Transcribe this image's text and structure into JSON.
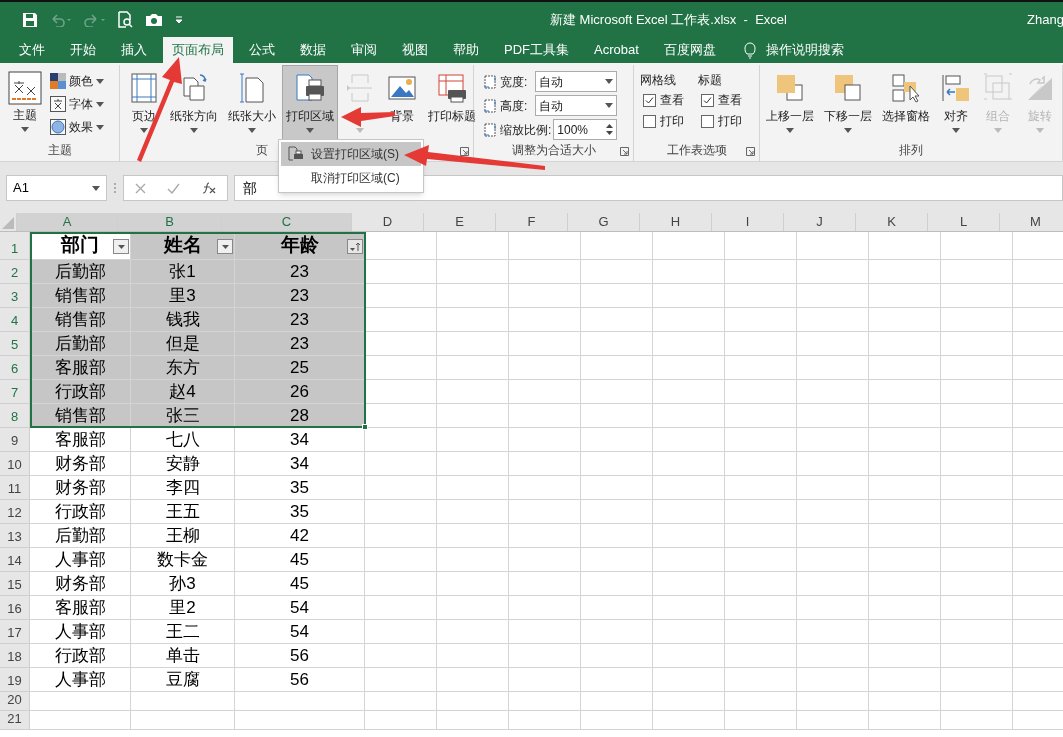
{
  "window": {
    "title": "新建 Microsoft Excel 工作表.xlsx  -  Excel",
    "user": "Zhang"
  },
  "tabs": [
    {
      "label": "文件",
      "selected": false
    },
    {
      "label": "开始",
      "selected": false
    },
    {
      "label": "插入",
      "selected": false
    },
    {
      "label": "页面布局",
      "selected": true
    },
    {
      "label": "公式",
      "selected": false
    },
    {
      "label": "数据",
      "selected": false
    },
    {
      "label": "审阅",
      "selected": false
    },
    {
      "label": "视图",
      "selected": false
    },
    {
      "label": "帮助",
      "selected": false
    },
    {
      "label": "PDF工具集",
      "selected": false
    },
    {
      "label": "Acrobat",
      "selected": false
    },
    {
      "label": "百度网盘",
      "selected": false
    }
  ],
  "tell_me": "操作说明搜索",
  "ribbon": {
    "groups": [
      {
        "kind": "theme",
        "label": "主题",
        "launcher": false,
        "large": {
          "label": "主题"
        },
        "small": [
          {
            "label": "颜色"
          },
          {
            "label": "字体"
          },
          {
            "label": "效果"
          }
        ]
      },
      {
        "kind": "large_buttons",
        "label": "页",
        "launcher": true,
        "items": [
          {
            "label": "页边",
            "pressed": false,
            "disabled": false,
            "has_menu": true
          },
          {
            "label": "纸张方向",
            "pressed": false,
            "disabled": false,
            "has_menu": true
          },
          {
            "label": "纸张大小",
            "pressed": false,
            "disabled": false,
            "has_menu": true
          },
          {
            "label": "打印区域",
            "pressed": true,
            "disabled": false,
            "has_menu": true
          },
          {
            "pressed": false,
            "disabled": true,
            "has_menu": true
          },
          {
            "label": "背景",
            "pressed": false,
            "disabled": false,
            "has_menu": false
          },
          {
            "label": "打印标题",
            "pressed": false,
            "disabled": false,
            "has_menu": false
          }
        ]
      },
      {
        "kind": "scale",
        "label": "调整为合适大小",
        "launcher": true,
        "fields": [
          {
            "label": "宽度:",
            "value": "自动",
            "kind": "dropdown"
          },
          {
            "label": "高度:",
            "value": "自动",
            "kind": "dropdown"
          },
          {
            "label": "缩放比例:",
            "value": "100%",
            "kind": "spin"
          }
        ]
      },
      {
        "kind": "sheet_options",
        "label": "工作表选项",
        "launcher": true,
        "sets": [
          {
            "title": "网格线",
            "options": [
              {
                "label": "查看",
                "checked": true
              },
              {
                "label": "打印",
                "checked": false
              }
            ]
          },
          {
            "title": "标题",
            "options": [
              {
                "label": "查看",
                "checked": true
              },
              {
                "label": "打印",
                "checked": false
              }
            ]
          }
        ]
      },
      {
        "kind": "large_buttons",
        "label": "排列",
        "launcher": false,
        "items": [
          {
            "label": "上移一层",
            "pressed": false,
            "disabled": false,
            "has_menu": true
          },
          {
            "label": "下移一层",
            "pressed": false,
            "disabled": false,
            "has_menu": true
          },
          {
            "label": "选择窗格",
            "pressed": false,
            "disabled": false,
            "has_menu": false
          },
          {
            "label": "对齐",
            "pressed": false,
            "disabled": false,
            "has_menu": true
          },
          {
            "label": "组合",
            "pressed": false,
            "disabled": true,
            "has_menu": true
          },
          {
            "label": "旋转",
            "pressed": false,
            "disabled": true,
            "has_menu": true
          }
        ]
      }
    ]
  },
  "menu": {
    "items": [
      {
        "label": "设置打印区域(S)",
        "selected": true
      },
      {
        "label": "取消打印区域(C)",
        "selected": false
      }
    ]
  },
  "formula_bar": {
    "name_box": "A1",
    "content": "部"
  },
  "sheet": {
    "columns": [
      {
        "label": "A",
        "selected": true
      },
      {
        "label": "B",
        "selected": true
      },
      {
        "label": "C",
        "selected": true
      },
      {
        "label": "D",
        "selected": false
      },
      {
        "label": "E",
        "selected": false
      },
      {
        "label": "F",
        "selected": false
      },
      {
        "label": "G",
        "selected": false
      },
      {
        "label": "H",
        "selected": false
      },
      {
        "label": "I",
        "selected": false
      },
      {
        "label": "J",
        "selected": false
      },
      {
        "label": "K",
        "selected": false
      },
      {
        "label": "L",
        "selected": false
      },
      {
        "label": "M",
        "selected": false
      }
    ],
    "header": {
      "number": "1",
      "selected": true,
      "cells": [
        {
          "text": "部门",
          "active": true,
          "kind": "dropdown"
        },
        {
          "text": "姓名",
          "active": false,
          "kind": "dropdown"
        },
        {
          "text": "年龄",
          "active": false,
          "kind": "sorted"
        }
      ]
    },
    "rows": [
      {
        "number": "2",
        "selected": true,
        "cells": [
          "后勤部",
          "张1",
          "23"
        ]
      },
      {
        "number": "3",
        "selected": true,
        "cells": [
          "销售部",
          "里3",
          "23"
        ]
      },
      {
        "number": "4",
        "selected": true,
        "cells": [
          "销售部",
          "钱我",
          "23"
        ]
      },
      {
        "number": "5",
        "selected": true,
        "cells": [
          "后勤部",
          "但是",
          "23"
        ]
      },
      {
        "number": "6",
        "selected": true,
        "cells": [
          "客服部",
          "东方",
          "25"
        ]
      },
      {
        "number": "7",
        "selected": true,
        "cells": [
          "行政部",
          "赵4",
          "26"
        ]
      },
      {
        "number": "8",
        "selected": true,
        "cells": [
          "销售部",
          "张三",
          "28"
        ]
      },
      {
        "number": "9",
        "selected": false,
        "cells": [
          "客服部",
          "七八",
          "34"
        ]
      },
      {
        "number": "10",
        "selected": false,
        "cells": [
          "财务部",
          "安静",
          "34"
        ]
      },
      {
        "number": "11",
        "selected": false,
        "cells": [
          "财务部",
          "李四",
          "35"
        ]
      },
      {
        "number": "12",
        "selected": false,
        "cells": [
          "行政部",
          "王五",
          "35"
        ]
      },
      {
        "number": "13",
        "selected": false,
        "cells": [
          "后勤部",
          "王柳",
          "42"
        ]
      },
      {
        "number": "14",
        "selected": false,
        "cells": [
          "人事部",
          "数卡金",
          "45"
        ]
      },
      {
        "number": "15",
        "selected": false,
        "cells": [
          "财务部",
          "孙3",
          "45"
        ]
      },
      {
        "number": "16",
        "selected": false,
        "cells": [
          "客服部",
          "里2",
          "54"
        ]
      },
      {
        "number": "17",
        "selected": false,
        "cells": [
          "人事部",
          "王二",
          "54"
        ]
      },
      {
        "number": "18",
        "selected": false,
        "cells": [
          "行政部",
          "单击",
          "56"
        ]
      },
      {
        "number": "19",
        "selected": false,
        "cells": [
          "人事部",
          "豆腐",
          "56"
        ]
      },
      {
        "number": "20",
        "selected": false
      },
      {
        "number": "21",
        "selected": false
      }
    ]
  }
}
